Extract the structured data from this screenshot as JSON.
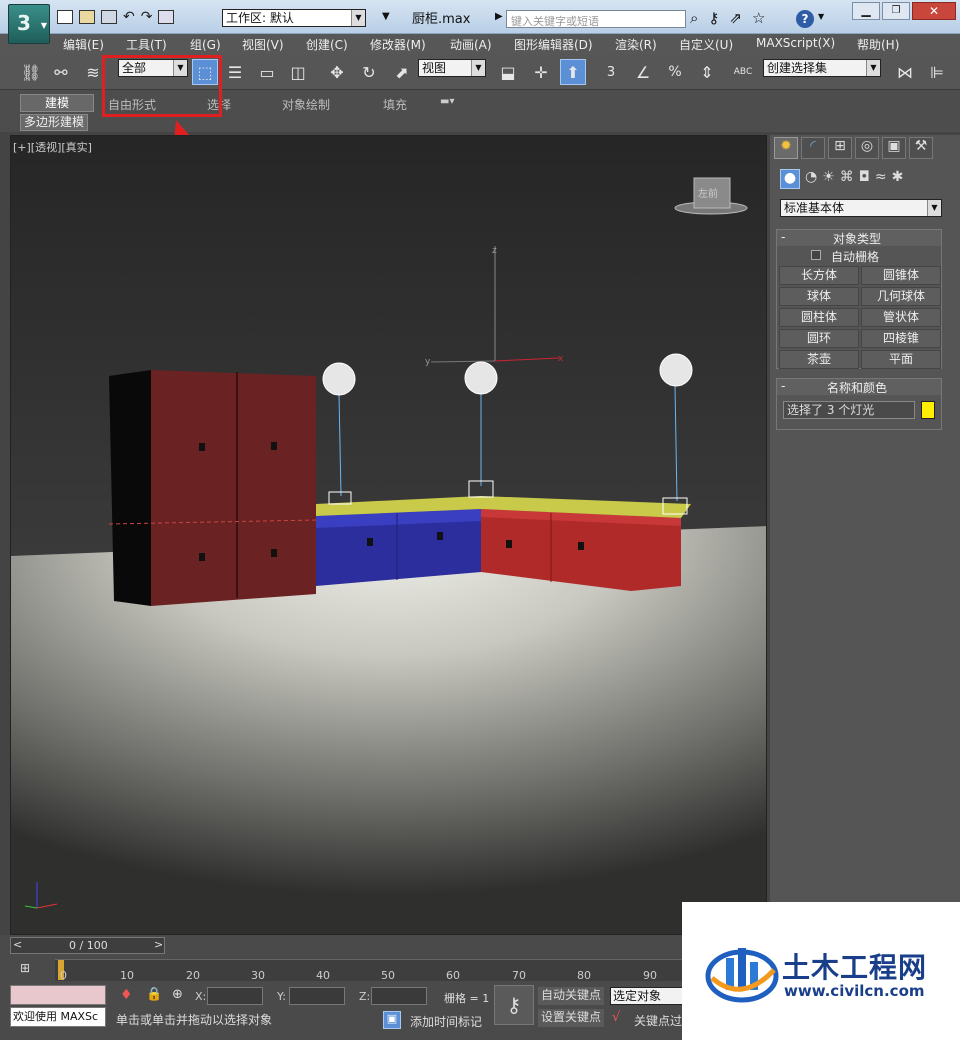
{
  "title": {
    "file": "厨柜.max",
    "workspace": "工作区: 默认",
    "search_placeholder": "键入关键字或短语",
    "help": "?"
  },
  "menu": [
    "编辑(E)",
    "工具(T)",
    "组(G)",
    "视图(V)",
    "创建(C)",
    "修改器(M)",
    "动画(A)",
    "图形编辑器(D)",
    "渲染(R)",
    "自定义(U)",
    "MAXScript(X)",
    "帮助(H)"
  ],
  "toolbar": {
    "filter": "全部",
    "ref_coord": "视图",
    "snap_labels": [
      "3",
      "%"
    ],
    "named_sel": "创建选择集",
    "abc": "ABC"
  },
  "ribbon": {
    "tabs": [
      "建模",
      "自由形式",
      "选择",
      "对象绘制",
      "填充"
    ],
    "subtab": "多边形建模"
  },
  "viewport": {
    "label": "[+][透视][真实]",
    "axis_z": "z",
    "axis_y": "y",
    "axis_x": "x",
    "cube_label": "左前"
  },
  "cmdpanel": {
    "category": "标准基本体",
    "rollout_object_type": "对象类型",
    "autogrid": "自动栅格",
    "buttons": [
      "长方体",
      "圆锥体",
      "球体",
      "几何球体",
      "圆柱体",
      "管状体",
      "圆环",
      "四棱锥",
      "茶壶",
      "平面"
    ],
    "rollout_name_color": "名称和颜色",
    "name_field": "选择了 3 个灯光",
    "color_swatch": "#ffee00"
  },
  "timeline": {
    "frame": "0 / 100",
    "ticks": [
      "0",
      "10",
      "20",
      "30",
      "40",
      "50",
      "60",
      "70",
      "80",
      "90"
    ],
    "x_label": "X:",
    "y_label": "Y:",
    "z_label": "Z:",
    "grid": "栅格 = 1",
    "auto_key": "自动关键点",
    "set_key": "设置关键点",
    "sel_obj": "选定对象",
    "key_filter": "关键点过",
    "welcome": "欢迎使用 MAXSc",
    "status": "单击或单击并拖动以选择对象",
    "add_time_tag": "添加时间标记"
  },
  "watermark": {
    "name": "土木工程网",
    "url": "www.civilcn.com"
  }
}
